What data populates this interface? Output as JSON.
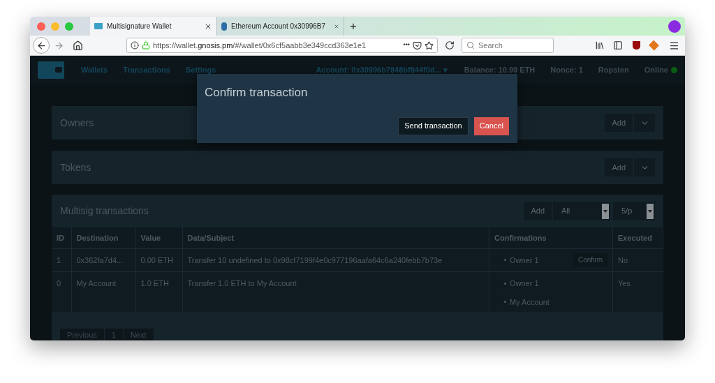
{
  "browser": {
    "tabs": [
      {
        "title": "Multisignature Wallet",
        "selected": true
      },
      {
        "title": "Ethereum Account 0x30996B7",
        "selected": false
      }
    ],
    "new_tab": "+",
    "url": {
      "prefix": "https://wallet.",
      "domain": "gnosis.pm",
      "path": "/#/wallet/0x6cf5aabb3e349ccd363e1e1"
    },
    "page_actions": "•••",
    "search": {
      "placeholder": "Search"
    }
  },
  "nav": {
    "links": [
      {
        "label": "Wallets"
      },
      {
        "label": "Transactions"
      },
      {
        "label": "Settings"
      }
    ],
    "account": "Account: 0x30996b7848bf844f0d...",
    "account_caret": "▾",
    "balance": "Balance: 10.99 ETH",
    "nonce": "Nonce: 1",
    "network": "Ropsten",
    "status": "Online",
    "online": true
  },
  "panels": [
    {
      "title": "Owners",
      "add": "Add"
    },
    {
      "title": "Tokens",
      "add": "Add"
    }
  ],
  "transactions": {
    "title": "Multisig transactions",
    "add": "Add",
    "filter": "All",
    "page_size": "5/p",
    "columns": [
      "ID",
      "Destination",
      "Value",
      "Data/Subject",
      "Confirmations",
      "Executed"
    ],
    "rows": [
      {
        "id": "1",
        "destination": "0x362fa7d4...",
        "value": "0.00 ETH",
        "subject": "Transfer 10 undefined to 0x98cf7199f4e0c977196aafa64c6a240febb7b73e",
        "confirmations": [
          "Owner 1"
        ],
        "action": "Confirm",
        "executed": "No"
      },
      {
        "id": "0",
        "destination": "My Account",
        "value": "1.0 ETH",
        "subject": "Transfer 1.0 ETH to My Account",
        "confirmations": [
          "Owner 1",
          "My Account"
        ],
        "executed": "Yes"
      }
    ],
    "pagination": [
      "Previous",
      "1",
      "Next"
    ]
  },
  "modal": {
    "title": "Confirm transaction",
    "buttons": [
      {
        "label": "Send transaction",
        "kind": "primary"
      },
      {
        "label": "Cancel",
        "kind": "danger"
      }
    ]
  }
}
